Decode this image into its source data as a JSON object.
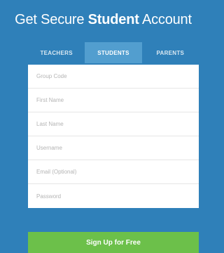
{
  "header": {
    "title_prefix": "Get Secure ",
    "title_bold": "Student",
    "title_suffix": " Account"
  },
  "tabs": [
    {
      "label": "TEACHERS",
      "active": false
    },
    {
      "label": "STUDENTS",
      "active": true
    },
    {
      "label": "PARENTS",
      "active": false
    }
  ],
  "form": {
    "fields": [
      {
        "placeholder": "Group Code",
        "value": ""
      },
      {
        "placeholder": "First Name",
        "value": ""
      },
      {
        "placeholder": "Last Name",
        "value": ""
      },
      {
        "placeholder": "Username",
        "value": ""
      },
      {
        "placeholder": "Email (Optional)",
        "value": ""
      },
      {
        "placeholder": "Password",
        "value": ""
      }
    ]
  },
  "signup": {
    "label": "Sign Up for Free"
  },
  "colors": {
    "background": "#2f80b9",
    "active_tab": "#529ecf",
    "signup_button": "#6cc04a"
  }
}
